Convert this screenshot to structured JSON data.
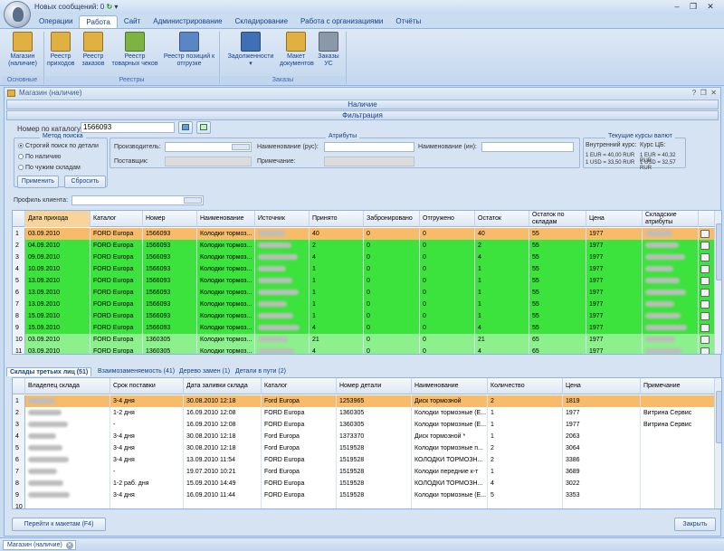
{
  "titlebar": {
    "messages": "Новых сообщений: 0"
  },
  "menu": {
    "tabs": [
      "Операции",
      "Работа",
      "Сайт",
      "Администрирование",
      "Складирование",
      "Работа с организациями",
      "Отчёты"
    ],
    "active": 1
  },
  "ribbon": {
    "buttons": [
      {
        "label": "Магазин (наличие)",
        "icon": "store-icon",
        "color": "#e0b040"
      },
      {
        "label": "Реестр приходов",
        "icon": "receipts-icon",
        "color": "#e0b040"
      },
      {
        "label": "Реестр заказов",
        "icon": "orders-icon",
        "color": "#e0b040"
      },
      {
        "label": "Реестр товарных чеков",
        "icon": "checks-icon",
        "color": "#7cb342"
      },
      {
        "label": "Реестр позиций к отгрузке",
        "icon": "list-icon",
        "color": "#5a86c5"
      },
      {
        "label": "Задолженности",
        "icon": "debt-icon",
        "color": "#3f6fb5"
      },
      {
        "label": "Макет документов",
        "icon": "template-icon",
        "color": "#e0b040"
      },
      {
        "label": "Заказы УС",
        "icon": "tools-icon",
        "color": "#8a98aa"
      }
    ],
    "groups": [
      "Основные",
      "Реестры",
      "Заказы"
    ]
  },
  "window": {
    "title": "Магазин (наличие)",
    "section_availability": "Наличие",
    "section_filter": "Фильтрация",
    "catalog_label": "Номер по каталогу:",
    "catalog_value": "1566093",
    "search_method_title": "Метод поиска",
    "search_options": [
      "Строгий поиск по детали",
      "По наличию",
      "По чужим складам"
    ],
    "apply": "Применить",
    "reset": "Сбросить",
    "attributes_title": "Атрибуты",
    "producer_label": "Производитель:",
    "supplier_label": "Поставщик:",
    "name_rus_label": "Наименование (рус):",
    "name_foreign_label": "Наименование (ин):",
    "note_label": "Примечание:",
    "rates_title": "Текущие курсы валют",
    "internal_rate_label": "Внутренний курс:",
    "cb_rate_label": "Курс ЦБ:",
    "internal_rates": [
      "1 EUR = 40,00 RUR",
      "1 USD = 33,50 RUR"
    ],
    "cb_rates": [
      "1 EUR = 40,32 RUR",
      "1 USD = 32,57 RUR"
    ],
    "client_profile_label": "Профиль клиента:"
  },
  "grid1": {
    "headers": [
      "Дата прихода",
      "Каталог",
      "Номер",
      "Наименование",
      "Источник",
      "Принято",
      "Забронировано",
      "Отгружено",
      "Остаток",
      "Остаток по складам",
      "Цена",
      "Складские атрибуты"
    ],
    "rows": [
      {
        "n": "1",
        "date": "03.09.2010",
        "cat": "FORD Europa",
        "num": "1566093",
        "name": "Колодки тормоз...",
        "acc": "40",
        "res": "0",
        "ship": "0",
        "rest": "40",
        "wh": "55",
        "price": "1977",
        "sel": true
      },
      {
        "n": "2",
        "date": "04.09.2010",
        "cat": "FORD Europa",
        "num": "1566093",
        "name": "Колодки тормоз...",
        "acc": "2",
        "res": "0",
        "ship": "0",
        "rest": "2",
        "wh": "55",
        "price": "1977"
      },
      {
        "n": "3",
        "date": "09.09.2010",
        "cat": "FORD Europa",
        "num": "1566093",
        "name": "Колодки тормоз...",
        "acc": "4",
        "res": "0",
        "ship": "0",
        "rest": "4",
        "wh": "55",
        "price": "1977"
      },
      {
        "n": "4",
        "date": "10.09.2010",
        "cat": "FORD Europa",
        "num": "1566093",
        "name": "Колодки тормоз...",
        "acc": "1",
        "res": "0",
        "ship": "0",
        "rest": "1",
        "wh": "55",
        "price": "1977"
      },
      {
        "n": "5",
        "date": "13.09.2010",
        "cat": "FORD Europa",
        "num": "1566093",
        "name": "Колодки тормоз...",
        "acc": "1",
        "res": "0",
        "ship": "0",
        "rest": "1",
        "wh": "55",
        "price": "1977"
      },
      {
        "n": "6",
        "date": "13.09.2010",
        "cat": "FORD Europa",
        "num": "1566093",
        "name": "Колодки тормоз...",
        "acc": "1",
        "res": "0",
        "ship": "0",
        "rest": "1",
        "wh": "55",
        "price": "1977"
      },
      {
        "n": "7",
        "date": "13.09.2010",
        "cat": "FORD Europa",
        "num": "1566093",
        "name": "Колодки тормоз...",
        "acc": "1",
        "res": "0",
        "ship": "0",
        "rest": "1",
        "wh": "55",
        "price": "1977"
      },
      {
        "n": "8",
        "date": "15.09.2010",
        "cat": "FORD Europa",
        "num": "1566093",
        "name": "Колодки тормоз...",
        "acc": "1",
        "res": "0",
        "ship": "0",
        "rest": "1",
        "wh": "55",
        "price": "1977"
      },
      {
        "n": "9",
        "date": "15.09.2010",
        "cat": "FORD Europa",
        "num": "1566093",
        "name": "Колодки тормоз...",
        "acc": "4",
        "res": "0",
        "ship": "0",
        "rest": "4",
        "wh": "55",
        "price": "1977"
      },
      {
        "n": "10",
        "date": "03.09.2010",
        "cat": "FORD Europa",
        "num": "1360305",
        "name": "Колодки тормоз...",
        "acc": "21",
        "res": "0",
        "ship": "0",
        "rest": "21",
        "wh": "65",
        "price": "1977"
      },
      {
        "n": "11",
        "date": "03.09.2010",
        "cat": "FORD Europa",
        "num": "1360305",
        "name": "Колодки тормоз...",
        "acc": "4",
        "res": "0",
        "ship": "0",
        "rest": "4",
        "wh": "65",
        "price": "1977"
      }
    ]
  },
  "subtabs": [
    "Склады третьих лиц (51)",
    "Взаимозаменяемость (41)",
    "Дерево замен (1)",
    "Детали в пути (2)"
  ],
  "grid2": {
    "headers": [
      "Владелец склада",
      "Срок поставки",
      "Дата заливки склада",
      "Каталог",
      "Номер детали",
      "Наименование",
      "Количество",
      "Цена",
      "Примечание"
    ],
    "rows": [
      {
        "n": "1",
        "term": "3-4 дня",
        "date": "30.08.2010 12:18",
        "cat": "Ford Europa",
        "num": "1253965",
        "name": "Диск тормозной",
        "qty": "2",
        "price": "1819",
        "note": "",
        "sel": true
      },
      {
        "n": "2",
        "term": "1-2 дня",
        "date": "16.09.2010 12:08",
        "cat": "FORD Europa",
        "num": "1360305",
        "name": "Колодки тормозные (Е...",
        "qty": "1",
        "price": "1977",
        "note": "Витрина Сервис"
      },
      {
        "n": "3",
        "term": "-",
        "date": "16.09.2010 12:08",
        "cat": "FORD Europa",
        "num": "1360305",
        "name": "Колодки тормозные (Е...",
        "qty": "1",
        "price": "1977",
        "note": "Витрина Сервис"
      },
      {
        "n": "4",
        "term": "3-4 дня",
        "date": "30.08.2010 12:18",
        "cat": "Ford Europa",
        "num": "1373370",
        "name": "Диск тормозной *",
        "qty": "1",
        "price": "2063",
        "note": ""
      },
      {
        "n": "5",
        "term": "3-4 дня",
        "date": "30.08.2010 12:18",
        "cat": "Ford Europa",
        "num": "1519528",
        "name": "Колодки тормозные п...",
        "qty": "2",
        "price": "3064",
        "note": ""
      },
      {
        "n": "6",
        "term": "3-4 дня",
        "date": "13.09.2010 11:54",
        "cat": "FORD Europa",
        "num": "1519528",
        "name": "КОЛОДКИ ТОРМОЗН...",
        "qty": "2",
        "price": "3386",
        "note": ""
      },
      {
        "n": "7",
        "term": "-",
        "date": "19.07.2010 10:21",
        "cat": "Ford Europa",
        "num": "1519528",
        "name": "Колодки передние к-т",
        "qty": "1",
        "price": "3689",
        "note": ""
      },
      {
        "n": "8",
        "term": "1-2 раб. дня",
        "date": "15.09.2010 14:49",
        "cat": "FORD Europa",
        "num": "1519528",
        "name": "КОЛОДКИ ТОРМОЗН...",
        "qty": "4",
        "price": "3022",
        "note": ""
      },
      {
        "n": "9",
        "term": "3-4 дня",
        "date": "16.09.2010 11:44",
        "cat": "FORD Europa",
        "num": "1519528",
        "name": "Колодки тормозные (Е...",
        "qty": "5",
        "price": "3353",
        "note": ""
      },
      {
        "n": "10",
        "term": "",
        "date": "",
        "cat": "",
        "num": "",
        "name": "",
        "qty": "",
        "price": "",
        "note": ""
      }
    ]
  },
  "footer": {
    "goto_template": "Перейти к макетам (F4)",
    "close": "Закрыть"
  },
  "status": {
    "doc_tab": "Магазин (наличие)"
  },
  "colors": {
    "selected": "#f7bb6a",
    "green": "#3ce33c",
    "light_green": "#8cf08c"
  }
}
